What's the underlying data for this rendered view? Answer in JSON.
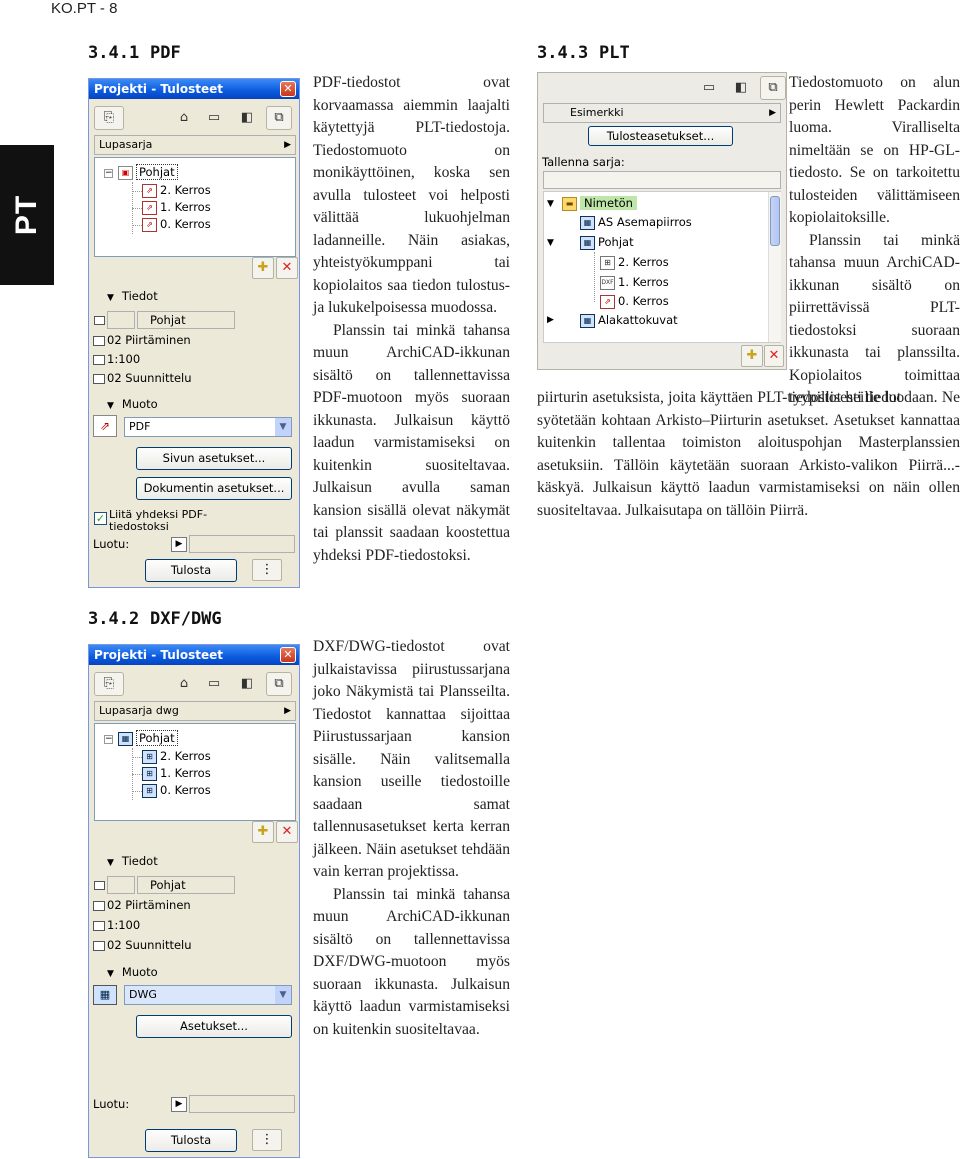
{
  "header": {
    "page_label": "KO.PT - 8",
    "language_tab": "PT"
  },
  "pdf_section": {
    "number": "3.4.1",
    "title": "PDF",
    "paragraphs": [
      "PDF-tiedostot ovat korvaamassa aiemmin laajalti käytettyjä PLT-tiedostoja. Tiedostomuoto on monikäyttöinen, koska sen avulla tulosteet voi helposti välittää lukuohjelman ladanneille. Näin asiakas, yhteistyökumppani tai kopiolaitos saa tiedon tulostus- ja lukukelpoisessa muodossa.",
      "Planssin tai minkä tahansa muun ArchiCAD-ikkunan sisältö on tallennettavissa PDF-muotoon myös suoraan ikkunasta. Julkaisun käyttö laadun varmistamiseksi on kuitenkin suositeltavaa. Julkaisun avulla saman kansion sisällä olevat näkymät tai planssit saadaan koostettua yhdeksi PDF-tiedostoksi."
    ],
    "window": {
      "title": "Projekti - Tulosteet",
      "set_dropdown": "Lupasarja",
      "tree": {
        "root": "Pohjat",
        "items": [
          "2. Kerros",
          "1. Kerros",
          "0. Kerros"
        ]
      },
      "tiedot_label": "Tiedot",
      "name_value": "Pohjat",
      "layer_value": "02 Piirtäminen",
      "scale_value": "1:100",
      "model_value": "02 Suunnittelu",
      "muoto_label": "Muoto",
      "format_value": "PDF",
      "page_setup_button": "Sivun asetukset...",
      "doc_setup_button": "Dokumentin asetukset...",
      "merge_checkbox": "Liitä yhdeksi PDF-tiedostoksi",
      "merge_checked": true,
      "created_label": "Luotu:",
      "publish_button": "Tulosta"
    }
  },
  "plt_section": {
    "number": "3.4.3",
    "title": "PLT",
    "paragraph_top": [
      "Tiedostomuoto on alun perin Hewlett Packardin luoma. Viralliselta nimeltään se on HP-GL-tiedosto. Se on tarkoitettu tulosteiden välittämiseen kopiolaitoksille.",
      "Planssin tai minkä tahansa muun ArchiCAD-ikkunan sisältö on piirrettävissä PLT-tiedostoksi suoraan ikkunasta tai planssilta. Kopiolaitos toimittaa tyypillisesti tiedot"
    ],
    "paragraph_bottom": "piirturin asetuksista, joita käyttäen PLT-tiedostot heille luodaan. Ne syötetään kohtaan Arkisto–Piirturin asetukset. Asetukset kannattaa kuitenkin tallentaa toimiston aloituspohjan Masterplanssien asetuksiin. Tällöin käytetään suoraan Arkisto-valikon Piirrä...-käskyä. Julkaisun käyttö laadun varmistamiseksi on näin ollen suositeltavaa. Julkaisutapa on tällöin Piirrä.",
    "window": {
      "example_dropdown": "Esimerkki",
      "print_setup_button": "Tulosteasetukset...",
      "save_set_label": "Tallenna sarja:",
      "tree": {
        "root": "Nimetön",
        "items": [
          "AS Asemapiirros",
          "Pohjat",
          "2. Kerros",
          "1. Kerros",
          "0. Kerros",
          "Alakattokuvat"
        ]
      }
    }
  },
  "dxf_section": {
    "number": "3.4.2",
    "title": "DXF/DWG",
    "paragraphs": [
      "DXF/DWG-tiedostot ovat julkaistavissa piirustussarjana joko Näkymistä tai Plansseilta. Tiedostot kannattaa sijoittaa Piirustussarjaan kansion sisälle. Näin valitsemalla kansion useille tiedostoille saadaan samat tallennusasetukset kerta kerran jälkeen. Näin asetukset tehdään vain kerran projektissa.",
      "Planssin tai minkä tahansa muun ArchiCAD-ikkunan sisältö on tallennettavissa DXF/DWG-muotoon myös suoraan ikkunasta. Julkaisun käyttö laadun varmistamiseksi on kuitenkin suositeltavaa."
    ],
    "window": {
      "title": "Projekti - Tulosteet",
      "set_dropdown": "Lupasarja dwg",
      "tree": {
        "root": "Pohjat",
        "items": [
          "2. Kerros",
          "1. Kerros",
          "0. Kerros"
        ]
      },
      "tiedot_label": "Tiedot",
      "name_value": "Pohjat",
      "layer_value": "02 Piirtäminen",
      "scale_value": "1:100",
      "model_value": "02 Suunnittelu",
      "muoto_label": "Muoto",
      "format_value": "DWG",
      "setup_button": "Asetukset...",
      "created_label": "Luotu:",
      "publish_button": "Tulosta"
    }
  },
  "colors": {
    "titlebar": "#0a5adf",
    "panel_bg": "#ece9d8",
    "lang_tab_bg": "#111111"
  }
}
